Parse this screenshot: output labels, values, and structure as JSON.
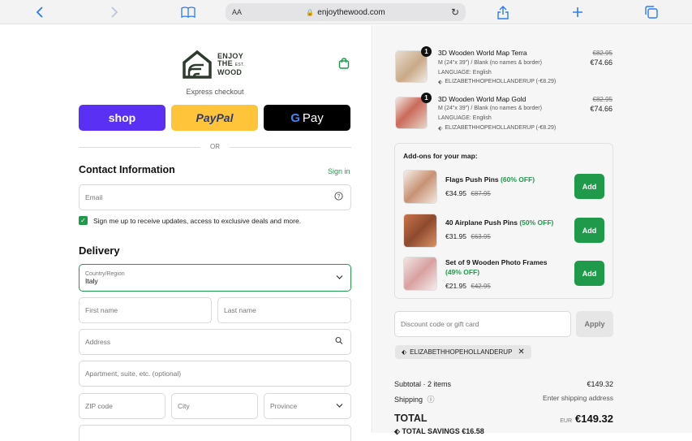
{
  "browser": {
    "aa_label": "AA",
    "url": "enjoythewood.com"
  },
  "brand": {
    "line1": "ENJOY",
    "line2": "THE",
    "line3": "WOOD",
    "est": "EST."
  },
  "checkout": {
    "express_label": "Express checkout",
    "shop_label": "shop",
    "paypal_label": "PayPal",
    "gpay_label": "Pay",
    "or_label": "OR"
  },
  "contact": {
    "title": "Contact Information",
    "signin_label": "Sign in",
    "email_placeholder": "Email",
    "newsletter_label": "Sign me up to receive updates, access to exclusive deals and more."
  },
  "delivery": {
    "title": "Delivery",
    "country_label": "Country/Region",
    "country_value": "Italy",
    "first_name_placeholder": "First name",
    "last_name_placeholder": "Last name",
    "address_placeholder": "Address",
    "apartment_placeholder": "Apartment, suite, etc. (optional)",
    "zip_placeholder": "ZIP code",
    "city_placeholder": "City",
    "province_placeholder": "Province"
  },
  "cart": {
    "items": [
      {
        "qty": "1",
        "title": "3D Wooden World Map Terra",
        "variant": "M (24\"x 39\") / Blank (no names & border)",
        "language": "LANGUAGE: English",
        "discount": "ELIZABETHHOPEHOLLANDERUP (-€8.29)",
        "old_price": "€82.95",
        "price": "€74.66"
      },
      {
        "qty": "1",
        "title": "3D Wooden World Map Gold",
        "variant": "M (24\"x 39\") / Blank (no names & border)",
        "language": "LANGUAGE: English",
        "discount": "ELIZABETHHOPEHOLLANDERUP (-€8.29)",
        "old_price": "€82.95",
        "price": "€74.66"
      }
    ]
  },
  "addons": {
    "title": "Add-ons for your map:",
    "add_label": "Add",
    "items": [
      {
        "name": "Flags Push Pins",
        "off": "(60% OFF)",
        "price": "€34.95",
        "old_price": "€87.95"
      },
      {
        "name": "40 Airplane Push Pins",
        "off": "(50% OFF)",
        "price": "€31.95",
        "old_price": "€63.95"
      },
      {
        "name": "Set of 9 Wooden Photo Frames",
        "off": "(49% OFF)",
        "price": "€21.95",
        "old_price": "€42.95"
      }
    ]
  },
  "discount": {
    "placeholder": "Discount code or gift card",
    "apply_label": "Apply",
    "applied_code": "ELIZABETHHOPEHOLLANDERUP"
  },
  "summary": {
    "subtotal_label": "Subtotal · 2 items",
    "subtotal_value": "€149.32",
    "shipping_label": "Shipping",
    "shipping_value": "Enter shipping address",
    "total_label": "TOTAL",
    "currency": "EUR",
    "total_value": "€149.32",
    "savings_label": "TOTAL SAVINGS €16.58"
  },
  "colors": {
    "accent": "#1f9a4a",
    "shop": "#5a31f4",
    "paypal": "#ffc439",
    "gpay": "#000000"
  }
}
